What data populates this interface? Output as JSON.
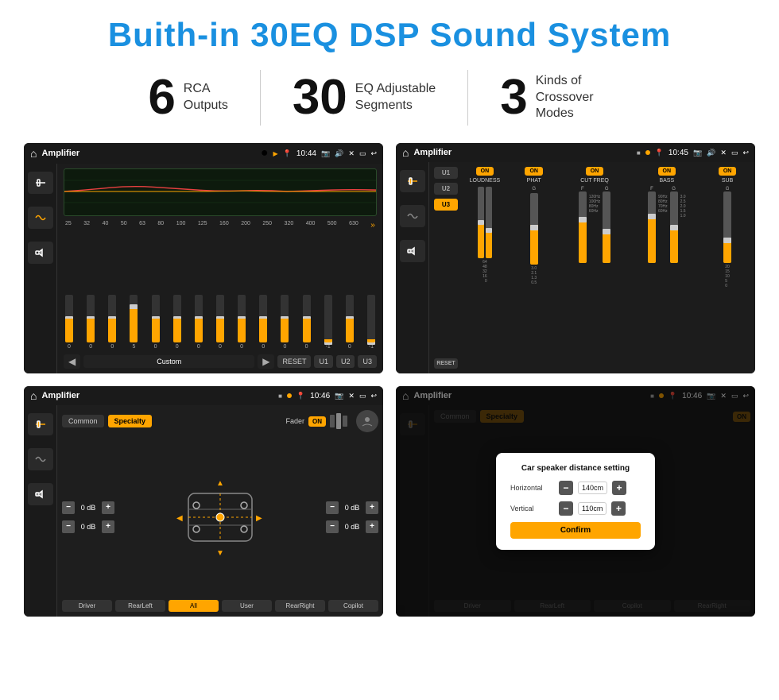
{
  "page": {
    "title": "Buith-in 30EQ DSP Sound System",
    "stats": [
      {
        "number": "6",
        "label": "RCA\nOutputs"
      },
      {
        "number": "30",
        "label": "EQ Adjustable\nSegments"
      },
      {
        "number": "3",
        "label": "Kinds of\nCrossover Modes"
      }
    ],
    "screens": [
      {
        "id": "eq-screen",
        "statusTitle": "Amplifier",
        "statusTime": "10:44",
        "type": "eq"
      },
      {
        "id": "crossover-screen",
        "statusTitle": "Amplifier",
        "statusTime": "10:45",
        "type": "crossover"
      },
      {
        "id": "fader-screen",
        "statusTitle": "Amplifier",
        "statusTime": "10:46",
        "type": "fader"
      },
      {
        "id": "dialog-screen",
        "statusTitle": "Amplifier",
        "statusTime": "10:46",
        "type": "dialog"
      }
    ],
    "eq": {
      "frequencies": [
        "25",
        "32",
        "40",
        "50",
        "63",
        "80",
        "100",
        "125",
        "160",
        "200",
        "250",
        "320",
        "400",
        "500",
        "630"
      ],
      "values": [
        "0",
        "0",
        "0",
        "5",
        "0",
        "0",
        "0",
        "0",
        "0",
        "0",
        "0",
        "0",
        "-1",
        "0",
        "-1"
      ],
      "presetLabel": "Custom",
      "buttons": [
        "RESET",
        "U1",
        "U2",
        "U3"
      ]
    },
    "crossover": {
      "presets": [
        "U1",
        "U2",
        "U3"
      ],
      "channels": [
        {
          "toggle": "ON",
          "label": "LOUDNESS"
        },
        {
          "toggle": "ON",
          "label": "PHAT"
        },
        {
          "toggle": "ON",
          "label": "CUT FREQ"
        },
        {
          "toggle": "ON",
          "label": "BASS"
        },
        {
          "toggle": "ON",
          "label": "SUB"
        }
      ],
      "resetLabel": "RESET"
    },
    "fader": {
      "tabs": [
        "Common",
        "Specialty"
      ],
      "faderLabel": "Fader",
      "toggleLabel": "ON",
      "dbValues": [
        "0 dB",
        "0 dB",
        "0 dB",
        "0 dB"
      ],
      "buttons": [
        "Driver",
        "RearLeft",
        "All",
        "User",
        "RearRight",
        "Copilot"
      ]
    },
    "dialog": {
      "title": "Car speaker distance setting",
      "horizontalLabel": "Horizontal",
      "horizontalValue": "140cm",
      "verticalLabel": "Vertical",
      "verticalValue": "110cm",
      "confirmLabel": "Confirm"
    }
  }
}
